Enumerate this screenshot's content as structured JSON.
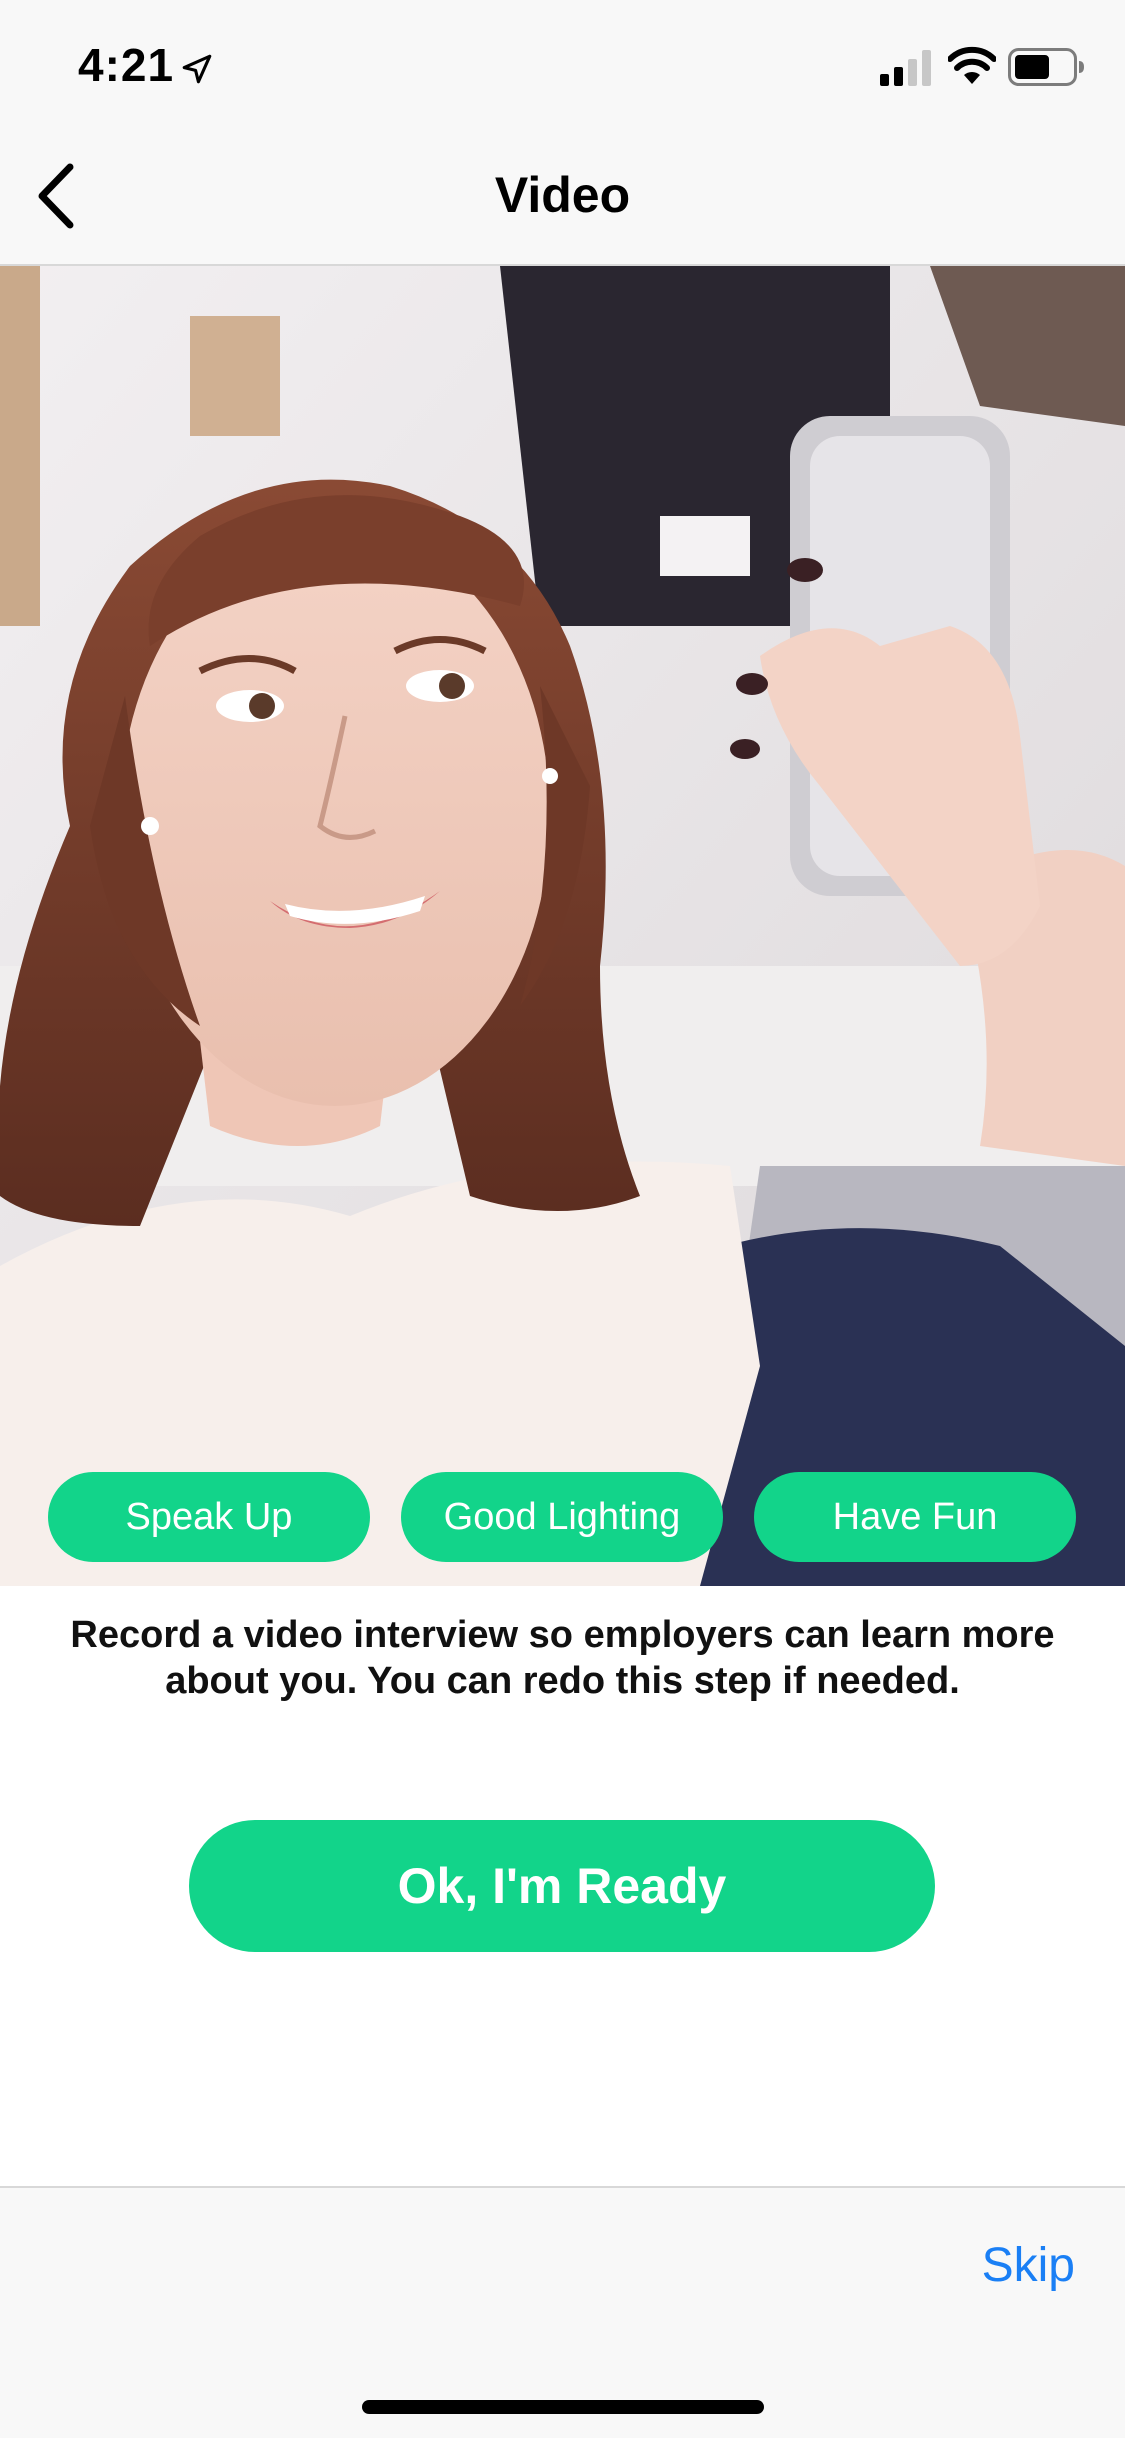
{
  "status_bar": {
    "time": "4:21",
    "icons": [
      "location-arrow-icon",
      "cellular-signal-icon",
      "wifi-icon",
      "battery-icon"
    ]
  },
  "nav": {
    "title": "Video",
    "back_icon": "chevron-left-icon"
  },
  "hero": {
    "image": "woman holding phone taking a selfie",
    "tips": [
      "Speak Up",
      "Good Lighting",
      "Have Fun"
    ]
  },
  "description": "Record a video interview so employers can learn more about you. You can redo this step if needed.",
  "primary_button": "Ok, I'm Ready",
  "bottom_bar": {
    "skip_label": "Skip"
  },
  "colors": {
    "accent_green": "#12d48a",
    "link_blue": "#1a7ff5",
    "bar_background": "#f8f8f8"
  }
}
